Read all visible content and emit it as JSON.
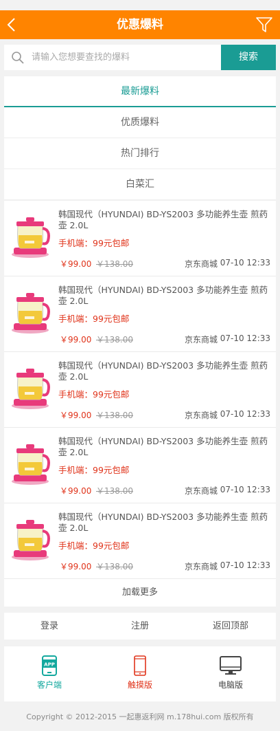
{
  "header": {
    "title": "优惠爆料"
  },
  "search": {
    "placeholder": "请输入您想要查找的爆料",
    "button_label": "搜索"
  },
  "tabs": [
    {
      "label": "最新爆料",
      "active": true
    },
    {
      "label": "优质爆料",
      "active": false
    },
    {
      "label": "热门排行",
      "active": false
    },
    {
      "label": "白菜汇",
      "active": false
    }
  ],
  "items": [
    {
      "title": "韩国现代（HYUNDAI) BD-YS2003 多功能养生壶 煎药壶 2.0L",
      "promo": "手机端：99元包邮",
      "price": "￥99.00",
      "old_price": "￥138.00",
      "store": "京东商城",
      "time": "07-10 12:33"
    },
    {
      "title": "韩国现代（HYUNDAI) BD-YS2003 多功能养生壶 煎药壶 2.0L",
      "promo": "手机端：99元包邮",
      "price": "￥99.00",
      "old_price": "￥138.00",
      "store": "京东商城",
      "time": "07-10 12:33"
    },
    {
      "title": "韩国现代（HYUNDAI) BD-YS2003 多功能养生壶 煎药壶 2.0L",
      "promo": "手机端：99元包邮",
      "price": "￥99.00",
      "old_price": "￥138.00",
      "store": "京东商城",
      "time": "07-10 12:33"
    },
    {
      "title": "韩国现代（HYUNDAI) BD-YS2003 多功能养生壶 煎药壶 2.0L",
      "promo": "手机端：99元包邮",
      "price": "￥99.00",
      "old_price": "￥138.00",
      "store": "京东商城",
      "time": "07-10 12:33"
    },
    {
      "title": "韩国现代（HYUNDAI) BD-YS2003 多功能养生壶 煎药壶 2.0L",
      "promo": "手机端：99元包邮",
      "price": "￥99.00",
      "old_price": "￥138.00",
      "store": "京东商城",
      "time": "07-10 12:33"
    }
  ],
  "load_more": "加载更多",
  "footer_links": {
    "login": "登录",
    "register": "注册",
    "back_to_top": "返回顶部"
  },
  "modes": {
    "app": {
      "label": "客户端",
      "icon": "app-icon",
      "color": "#13a89e",
      "icon_text": "APP"
    },
    "touch": {
      "label": "触摸版",
      "icon": "phone-icon",
      "color": "#e0331a"
    },
    "pc": {
      "label": "电脑版",
      "icon": "monitor-icon",
      "color": "#444444"
    }
  },
  "copyright": "Copyright © 2012-2015 一起惠返利网 m.178hui.com 版权所有",
  "colors": {
    "header": "#ff8400",
    "accent": "#1a9c94",
    "price": "#e0331a"
  }
}
